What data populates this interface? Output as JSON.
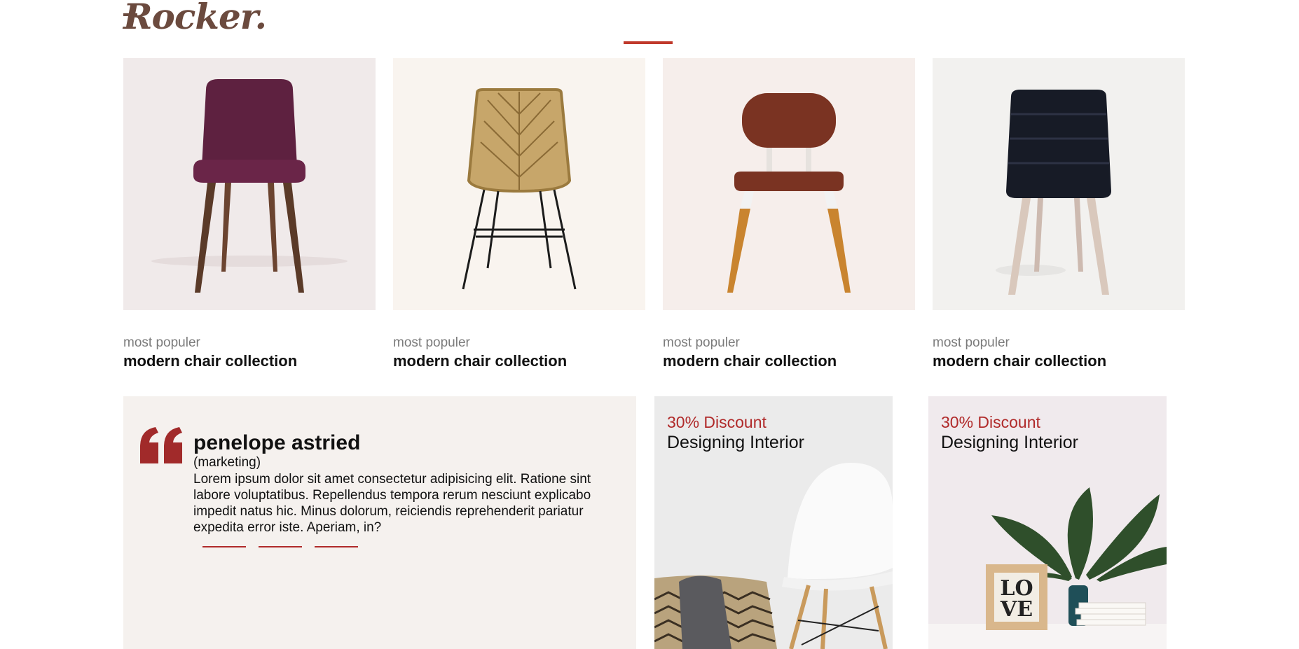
{
  "brand": {
    "logo_text": "Rocker",
    "logo_dot": "."
  },
  "products": [
    {
      "subtitle": "most populer",
      "title": "modern chair collection",
      "image": "purple-upholstered-chair",
      "bg": "#f0eaea"
    },
    {
      "subtitle": "most populer",
      "title": "modern chair collection",
      "image": "rattan-wire-chair",
      "bg": "#f9f4ef"
    },
    {
      "subtitle": "most populer",
      "title": "modern chair collection",
      "image": "brown-leather-chair",
      "bg": "#f6eeeb"
    },
    {
      "subtitle": "most populer",
      "title": "modern chair collection",
      "image": "black-quilted-chair",
      "bg": "#f2f1ef"
    }
  ],
  "testimonial": {
    "name": "penelope astried",
    "role": "(marketing)",
    "body": "Lorem ipsum dolor sit amet consectetur adipisicing elit. Ratione sint labore voluptatibus. Repellendus tempora rerum nesciunt explicabo impedit natus hic. Minus dolorum, reiciendis reprehenderit pariatur expedita error iste. Aperiam, in?",
    "quote_icon": "quote-icon"
  },
  "promos": [
    {
      "discount": "30% Discount",
      "title": "Designing Interior",
      "image": "white-chair-basket"
    },
    {
      "discount": "30% Discount",
      "title": "Designing Interior",
      "image": "plant-love-frame"
    }
  ],
  "colors": {
    "accent": "#b02a2a",
    "brand": "#6b4a3e"
  }
}
